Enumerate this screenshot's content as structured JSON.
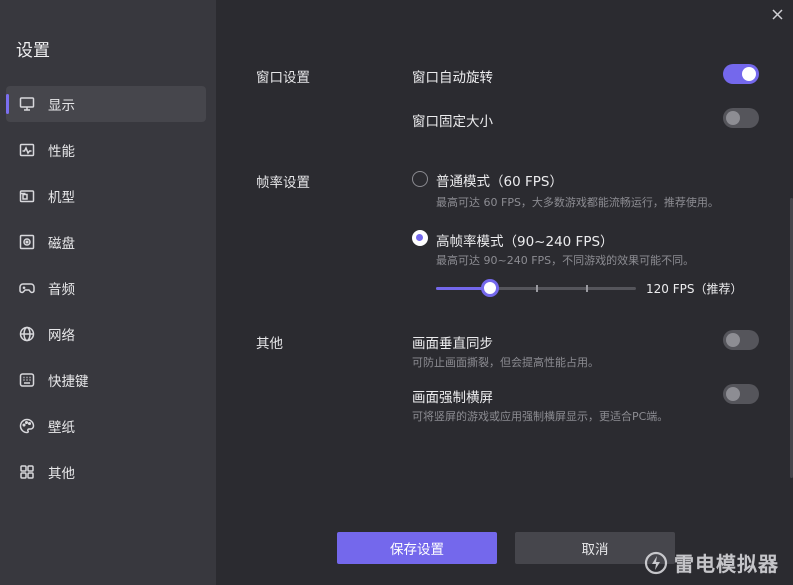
{
  "sidebar": {
    "title": "设置",
    "items": [
      {
        "label": "显示",
        "icon": "monitor-icon"
      },
      {
        "label": "性能",
        "icon": "performance-icon"
      },
      {
        "label": "机型",
        "icon": "device-model-icon"
      },
      {
        "label": "磁盘",
        "icon": "disk-icon"
      },
      {
        "label": "音频",
        "icon": "gamepad-audio-icon"
      },
      {
        "label": "网络",
        "icon": "globe-icon"
      },
      {
        "label": "快捷键",
        "icon": "keyboard-icon"
      },
      {
        "label": "壁纸",
        "icon": "palette-icon"
      },
      {
        "label": "其他",
        "icon": "grid-icon"
      }
    ],
    "active_index": 0
  },
  "window": {
    "section": {
      "label": "窗口设置",
      "auto_rotate": {
        "label": "窗口自动旋转",
        "enabled": true
      },
      "fixed_size": {
        "label": "窗口固定大小",
        "enabled": false
      }
    }
  },
  "framerate": {
    "label": "帧率设置",
    "normal": {
      "label": "普通模式（60 FPS）",
      "hint": "最高可达 60 FPS，大多数游戏都能流畅运行，推荐使用。",
      "checked": false
    },
    "high": {
      "label": "高帧率模式（90~240 FPS）",
      "hint": "最高可达 90~240 FPS，不同游戏的效果可能不同。",
      "checked": true
    },
    "slider": {
      "value_label": "120 FPS（推荐）",
      "fraction": 0.27
    }
  },
  "other": {
    "label": "其他",
    "vsync": {
      "label": "画面垂直同步",
      "hint": "可防止画面撕裂，但会提高性能占用。",
      "enabled": false
    },
    "force_landscape": {
      "label": "画面强制横屏",
      "hint": "可将竖屏的游戏或应用强制横屏显示，更适合PC端。",
      "enabled": false
    }
  },
  "buttons": {
    "save": "保存设置",
    "cancel": "取消"
  },
  "brand": {
    "name": "雷电模拟器"
  },
  "colors": {
    "accent": "#7468ec",
    "sidebar_bg": "#38383e",
    "main_bg": "#2b2b30"
  }
}
